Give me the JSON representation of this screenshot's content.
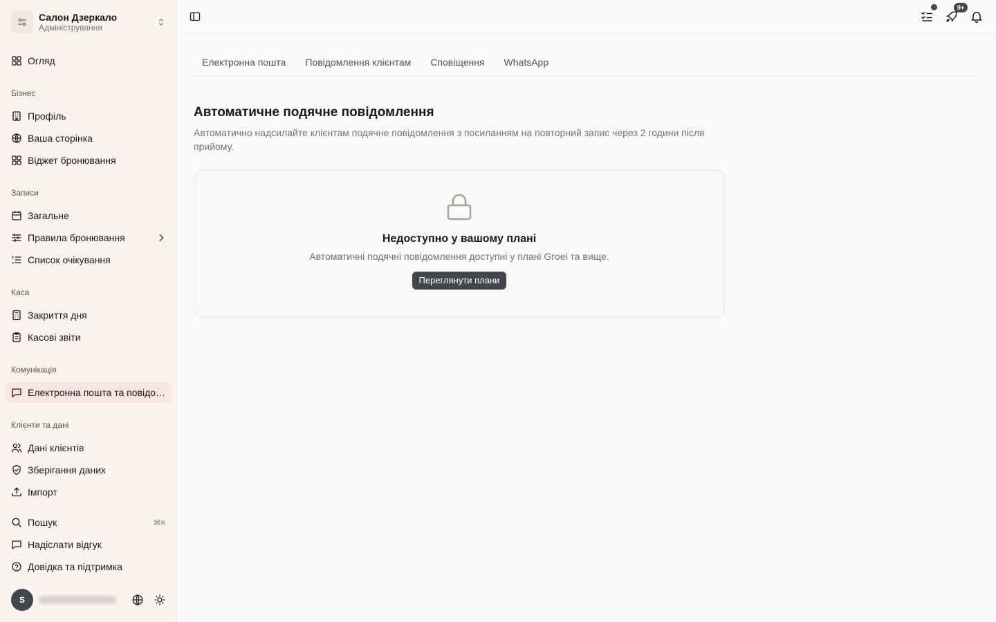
{
  "org": {
    "name": "Салон Дзеркало",
    "subtitle": "Адміністрування"
  },
  "nav": {
    "overview": "Огляд",
    "sections": {
      "business": "Бізнес",
      "appointments": "Записи",
      "cash": "Каса",
      "communication": "Комунікація",
      "clients": "Клієнти та дані"
    },
    "business": [
      "Профіль",
      "Ваша сторінка",
      "Віджет бронювання"
    ],
    "appointments": [
      "Загальне",
      "Правила бронювання",
      "Список очікування"
    ],
    "cash": [
      "Закриття дня",
      "Касові звіти"
    ],
    "communication": [
      "Електронна пошта та повідомлення"
    ],
    "clients": [
      "Дані клієнтів",
      "Зберігання даних",
      "Імпорт"
    ],
    "footer": {
      "search": "Пошук",
      "search_shortcut": "⌘K",
      "feedback": "Надіслати відгук",
      "help": "Довідка та підтримка"
    }
  },
  "user": {
    "avatar_initial": "S"
  },
  "topbar": {
    "notifications_badge": "9+"
  },
  "tabs": [
    "Електронна пошта",
    "Повідомлення клієнтам",
    "Сповіщення",
    "WhatsApp"
  ],
  "content": {
    "title": "Автоматичне подячне повідомлення",
    "description": "Автоматично надсилайте клієнтам подячне повідомлення з посиланням на повторний запис через 2 години після прийому.",
    "locked": {
      "title": "Недоступно у вашому плані",
      "description": "Автоматичні подячні повідомлення доступні у плані Groei та вище.",
      "button": "Переглянути плани"
    }
  },
  "colors": {
    "sidebar_bg": "#fcf3ee",
    "page_bg": "#fbfaf8",
    "accent_dark": "#44464f"
  }
}
